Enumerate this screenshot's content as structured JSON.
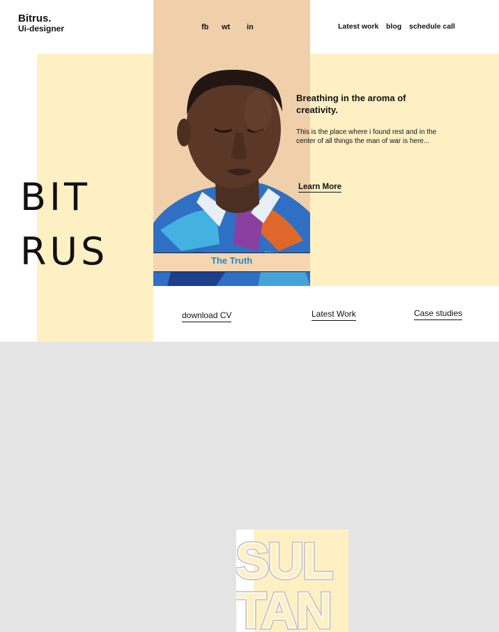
{
  "brand": {
    "name": "Bitrus.",
    "role": "Ui-designer"
  },
  "social": {
    "fb": "fb",
    "wt": "wt",
    "in": "in"
  },
  "nav": {
    "latest_work": "Latest work",
    "blog": "blog",
    "schedule_call": "schedule call"
  },
  "hero": {
    "big_line1": "BIT",
    "big_line2": "RUS",
    "headline": "Breathing in the aroma of creativity.",
    "description": "This is the place where i found rest and in the center of all things the man of war is here...",
    "learn_more": "Learn More",
    "photo_caption": "The Truth"
  },
  "links": {
    "download_cv": "download CV",
    "latest_work": "Latest Work",
    "case_studies": "Case studies"
  },
  "sultan": {
    "line1": "SUL",
    "line2": "TAN"
  },
  "colors": {
    "cream": "#fff0c4",
    "peach": "#f0d0aa",
    "caption_blue": "#1e88d0",
    "gray_bg": "#e4e4e4"
  }
}
